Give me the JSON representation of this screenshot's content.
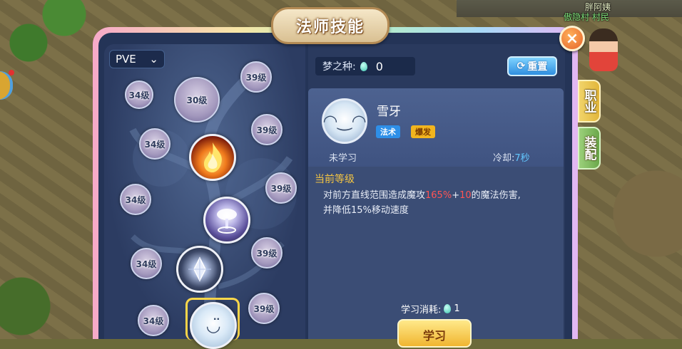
{
  "world": {
    "npc_name": "胖阿姨",
    "npc_title": "傲隐村 村民"
  },
  "panel": {
    "title": "法师技能",
    "close_label": "×"
  },
  "tree": {
    "mode_select": "PVE",
    "locked_nodes": [
      {
        "label": "34级"
      },
      {
        "label": "30级"
      },
      {
        "label": "39级"
      },
      {
        "label": "39级"
      },
      {
        "label": "34级"
      },
      {
        "label": "34级"
      },
      {
        "label": "39级"
      },
      {
        "label": "34级"
      },
      {
        "label": "39级"
      },
      {
        "label": "34级"
      },
      {
        "label": "39级"
      }
    ]
  },
  "seed": {
    "label": "梦之种:",
    "value": "0"
  },
  "reset_button": "重置",
  "skill": {
    "name": "雪牙",
    "tags": [
      "法术",
      "爆发"
    ],
    "state": "未学习",
    "cooldown_label": "冷却:",
    "cooldown_value": "7秒",
    "level_title": "当前等级",
    "desc_prefix": "对前方直线范围造成魔攻",
    "desc_percent": "165%",
    "desc_plus": "+",
    "desc_flat": "10",
    "desc_suffix": "的魔法伤害,",
    "desc_line2": "并降低15%移动速度"
  },
  "cost": {
    "label": "学习消耗:",
    "value": "1"
  },
  "learn_button": "学习",
  "side_tabs": {
    "job": "职业",
    "equip": "装配"
  },
  "colors": {
    "panel_bg": "#243457",
    "accent_gold": "#f4c542",
    "highlight_red": "#ff5454",
    "cooldown_blue": "#62c8ff"
  }
}
